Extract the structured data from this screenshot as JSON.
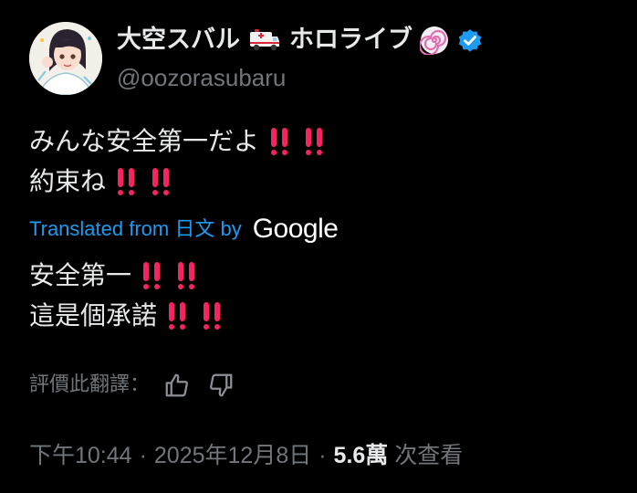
{
  "author": {
    "display_name_part1": "大空スバル",
    "display_name_part2": "ホロライブ",
    "handle": "@oozorasubaru",
    "name_emoji": "ambulance-icon",
    "affiliate_badge": "hololive-spiral-badge-icon",
    "verified_badge": "verified-check-icon",
    "verified_color": "#1d9bf0"
  },
  "tweet": {
    "original_lines": [
      "みんな安全第一だよ",
      "約束ね"
    ],
    "translated_lines": [
      "安全第一",
      "這是個承諾"
    ],
    "emphasis_emoji": "double-exclamation-icon",
    "emphasis_color": "#f4245e"
  },
  "translation": {
    "label": "Translated from 日文 by",
    "provider": "Google",
    "link_color": "#1d9bf0"
  },
  "rating": {
    "label": "評價此翻譯："
  },
  "meta": {
    "time": "下午10:44",
    "separator": "·",
    "date": "2025年12月8日",
    "views_count": "5.6萬",
    "views_label": "次查看"
  }
}
